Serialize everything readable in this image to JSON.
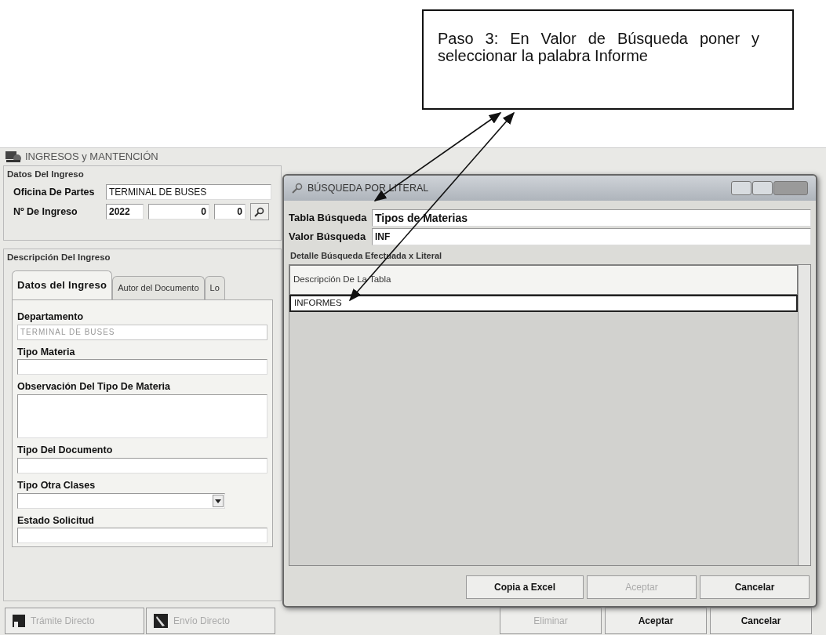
{
  "callout": {
    "text": "Paso 3: En Valor de Búsqueda poner y seleccionar la palabra Informe"
  },
  "main_window": {
    "title": "INGRESOS y MANTENCIÓN",
    "datos_group": {
      "title": "Datos Del Ingreso",
      "oficina": {
        "label": "Oficina De Partes",
        "value": "TERMINAL DE BUSES"
      },
      "ingreso": {
        "label": "Nº De Ingreso",
        "values": [
          "2022",
          "0",
          "0"
        ]
      }
    },
    "descripcion_group": {
      "title": "Descripción Del Ingreso",
      "tabs": [
        {
          "label": "Datos del Ingreso",
          "selected": true
        },
        {
          "label": "Autor del Documento",
          "selected": false
        },
        {
          "label": "Lo",
          "selected": false
        }
      ],
      "fields": [
        {
          "label": "Departamento",
          "kind": "text",
          "value": "TERMINAL DE BUSES",
          "disabled": true
        },
        {
          "label": "Tipo Materia",
          "kind": "text",
          "disabled": false
        },
        {
          "label": "Observación Del Tipo De Materia",
          "kind": "textarea",
          "disabled": false
        },
        {
          "label": "Tipo Del Documento",
          "kind": "text",
          "disabled": false
        },
        {
          "label": "Tipo Otra Clases",
          "kind": "select",
          "disabled": false
        },
        {
          "label": "Estado Solicitud",
          "kind": "text",
          "disabled": false
        }
      ]
    },
    "left_buttons": [
      {
        "label": "Trámite Directo",
        "kind": "door",
        "disabled": true
      },
      {
        "label": "Envío Directo",
        "kind": "pen",
        "disabled": true
      }
    ],
    "right_buttons": [
      {
        "label": "Eliminar",
        "disabled": true
      },
      {
        "label": "Aceptar",
        "disabled": false
      },
      {
        "label": "Cancelar",
        "disabled": false
      }
    ]
  },
  "dialog": {
    "title": "BÚSQUEDA POR LITERAL",
    "tabla": {
      "label": "Tabla Búsqueda",
      "value": "Tipos de Materias"
    },
    "valor": {
      "label": "Valor Búsqueda",
      "value": "INF"
    },
    "group_title": "Detalle Búsqueda Efectuada x Literal",
    "grid_header": "Descripción De La Tabla",
    "rows": [
      {
        "text": "INFORMES",
        "selected": true
      }
    ],
    "buttons": [
      {
        "label": "Copia a Excel",
        "disabled": false
      },
      {
        "label": "Aceptar",
        "disabled": true
      },
      {
        "label": "Cancelar",
        "disabled": false
      }
    ]
  }
}
